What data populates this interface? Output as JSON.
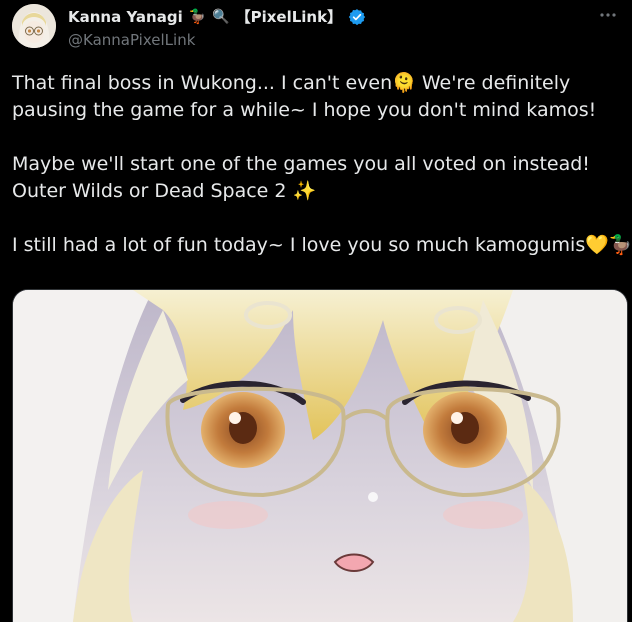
{
  "author": {
    "name": "Kanna Yanagi",
    "badge_text": "【PixelLink】",
    "emoji_duck": "🦆",
    "emoji_magnifier": "🔍",
    "handle": "@KannaPixelLink"
  },
  "icons": {
    "verified": "verified-badge-icon",
    "more": "more-options-icon"
  },
  "tweet": {
    "line1": "That final boss in Wukong... I can't even🫠 We're definitely",
    "line2": "pausing the game for a while~ I hope you don't mind kamos!",
    "line3": "Maybe we'll start one of the games you all voted on instead!",
    "line4": "Outer Wilds or Dead Space 2 ✨",
    "line5": "I still had a lot of fun today~ I love you so much kamogumis💛🦆"
  },
  "colors": {
    "background": "#000000",
    "text": "#e7e9ea",
    "muted": "#71767b",
    "verified": "#1d9bf0"
  }
}
